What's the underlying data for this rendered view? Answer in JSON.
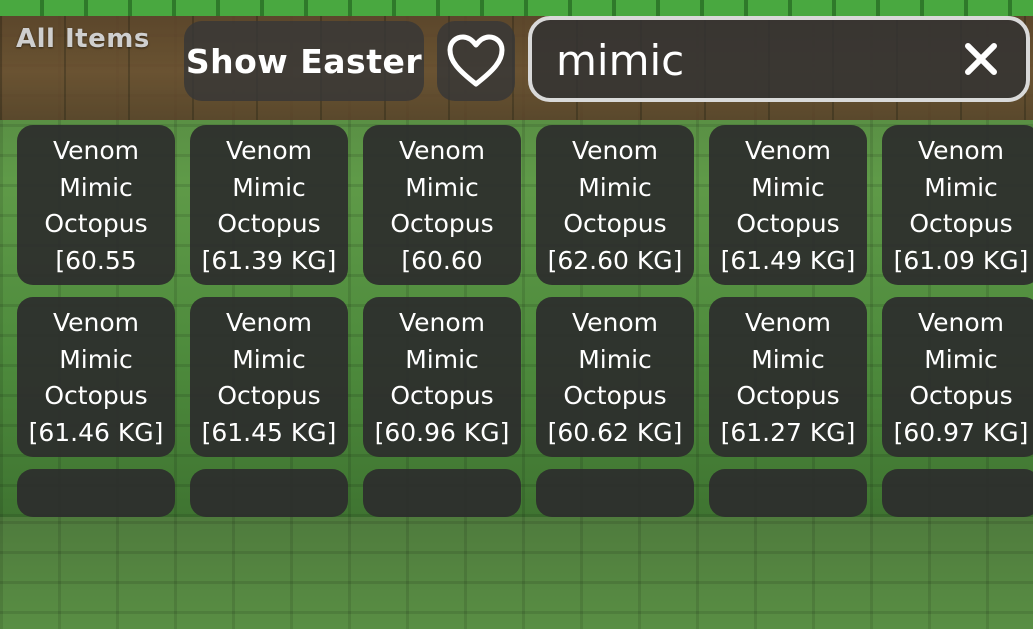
{
  "header": {
    "section_label": "All Items",
    "show_button_label": "Show Easter",
    "favorite_icon": "heart-icon",
    "search": {
      "value": "mimic",
      "clear_icon": "close-icon",
      "clear_label": "X"
    }
  },
  "items": [
    {
      "line1": "Venom",
      "line2": "Mimic",
      "line3": "Octopus",
      "line4": "[60.55"
    },
    {
      "line1": "Venom",
      "line2": "Mimic",
      "line3": "Octopus",
      "line4": "[61.39 KG]"
    },
    {
      "line1": "Venom",
      "line2": "Mimic",
      "line3": "Octopus",
      "line4": "[60.60"
    },
    {
      "line1": "Venom",
      "line2": "Mimic",
      "line3": "Octopus",
      "line4": "[62.60 KG]"
    },
    {
      "line1": "Venom",
      "line2": "Mimic",
      "line3": "Octopus",
      "line4": "[61.49 KG]"
    },
    {
      "line1": "Venom",
      "line2": "Mimic",
      "line3": "Octopus",
      "line4": "[61.09 KG]"
    },
    {
      "line1": "Venom",
      "line2": "Mimic",
      "line3": "Octopus",
      "line4": "[61.46 KG]"
    },
    {
      "line1": "Venom",
      "line2": "Mimic",
      "line3": "Octopus",
      "line4": "[61.45 KG]"
    },
    {
      "line1": "Venom",
      "line2": "Mimic",
      "line3": "Octopus",
      "line4": "[60.96 KG]"
    },
    {
      "line1": "Venom",
      "line2": "Mimic",
      "line3": "Octopus",
      "line4": "[60.62 KG]"
    },
    {
      "line1": "Venom",
      "line2": "Mimic",
      "line3": "Octopus",
      "line4": "[61.27 KG]"
    },
    {
      "line1": "Venom",
      "line2": "Mimic",
      "line3": "Octopus",
      "line4": "[60.97 KG]"
    }
  ],
  "colors": {
    "panel": "#2d2d2d",
    "text": "#ffffff",
    "search_border": "#d9d9d9",
    "ground": "#5f9a48",
    "fence": "#6e4a30"
  }
}
